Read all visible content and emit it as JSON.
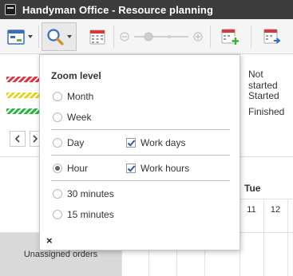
{
  "window": {
    "title": "Handyman Office - Resource planning"
  },
  "legend": {
    "swatches": [
      {
        "color": "#e8303a"
      },
      {
        "color": "#e6d21a"
      },
      {
        "color": "#23b83a"
      }
    ],
    "statuses": [
      "Not started",
      "Started",
      "Finished"
    ]
  },
  "zoom_popup": {
    "title": "Zoom level",
    "options": {
      "month": "Month",
      "week": "Week",
      "day": "Day",
      "hour": "Hour",
      "min30": "30 minutes",
      "min15": "15 minutes"
    },
    "selected": "Hour",
    "checks": {
      "work_days": {
        "label": "Work days",
        "checked": true
      },
      "work_hours": {
        "label": "Work hours",
        "checked": true
      }
    },
    "close": "×"
  },
  "schedule": {
    "day": "Tue",
    "hours": [
      "11",
      "12"
    ],
    "unassigned_label": "Unassigned orders"
  },
  "icons": {
    "app": "app-icon",
    "calendar_view": "calendar-view-icon",
    "zoom": "zoom-icon",
    "calendar": "calendar-icon",
    "zoom_out": "zoom-out-icon",
    "zoom_in": "zoom-in-icon",
    "add_event": "calendar-add-icon",
    "export": "calendar-export-icon"
  }
}
